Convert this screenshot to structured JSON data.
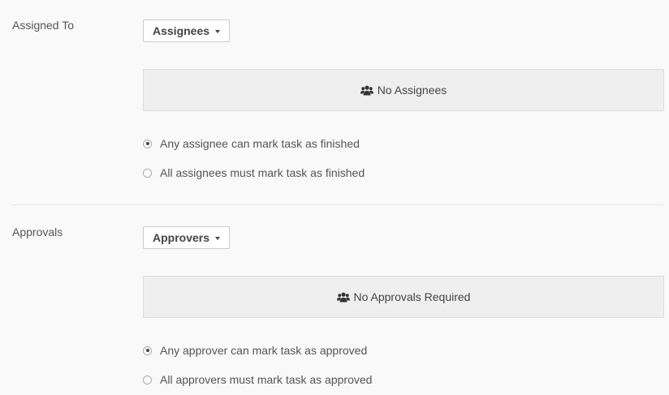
{
  "assigned_to": {
    "label": "Assigned To",
    "dropdown_label": "Assignees",
    "empty_text": "No Assignees",
    "options": [
      {
        "label": "Any assignee can mark task as finished",
        "checked": true
      },
      {
        "label": "All assignees must mark task as finished",
        "checked": false
      }
    ]
  },
  "approvals": {
    "label": "Approvals",
    "dropdown_label": "Approvers",
    "empty_text": "No Approvals Required",
    "options": [
      {
        "label": "Any approver can mark task as approved",
        "checked": true
      },
      {
        "label": "All approvers must mark task as approved",
        "checked": false
      }
    ]
  },
  "icons": {
    "group": "users-icon",
    "caret": "caret-down-icon"
  }
}
